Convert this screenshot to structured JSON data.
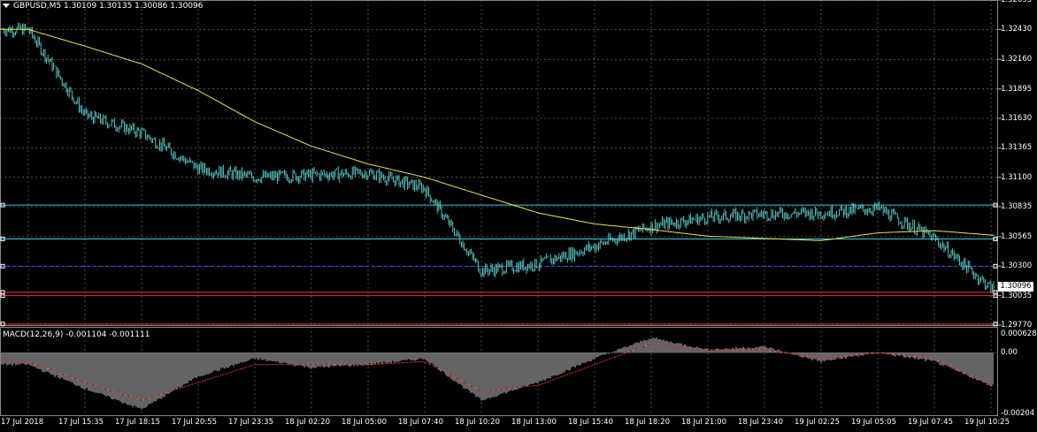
{
  "header": {
    "symbol_line": "GBPUSD,M5  1.30109 1.30135 1.30086 1.30096"
  },
  "price_axis": {
    "labels": [
      "1.32695",
      "1.32430",
      "1.32160",
      "1.31895",
      "1.31630",
      "1.31365",
      "1.31100",
      "1.30835",
      "1.30565",
      "1.30300",
      "1.30035",
      "1.29770"
    ],
    "current_price": "1.30096"
  },
  "time_axis": {
    "labels": [
      "17 Jul 2018",
      "17 Jul 15:35",
      "17 Jul 18:15",
      "17 Jul 20:55",
      "17 Jul 23:35",
      "18 Jul 02:20",
      "18 Jul 05:00",
      "18 Jul 07:40",
      "18 Jul 10:20",
      "18 Jul 13:00",
      "18 Jul 15:40",
      "18 Jul 18:20",
      "18 Jul 21:00",
      "18 Jul 23:40",
      "19 Jul 02:25",
      "19 Jul 05:05",
      "19 Jul 07:45",
      "19 Jul 10:25"
    ]
  },
  "indicator": {
    "title": "MACD(12,26,9) -0.001104 -0.001111",
    "axis_labels": [
      "0.000628",
      "0.00",
      "-0.00204"
    ]
  },
  "colors": {
    "background": "#000000",
    "grid": "#7c7c7c",
    "candles": "#5fd3d3",
    "moving_average": "#e6e64a",
    "level_cyan": "#3cc9d9",
    "level_blue": "#3355ff",
    "level_red": "#e03030",
    "macd_hist": "#c8c8c8",
    "macd_signal": "#e03030"
  },
  "chart_data": [
    {
      "type": "line",
      "title": "",
      "series": [
        {
          "x": [
            "17 Jul 2018",
            "17 Jul 15:35",
            "17 Jul 18:15",
            "17 Jul 20:55",
            "17 Jul 23:35",
            "18 Jul 02:20",
            "18 Jul 05:00",
            "18 Jul 07:40",
            "18 Jul 10:20",
            "18 Jul 13:00",
            "18 Jul 15:40",
            "18 Jul 18:20",
            "18 Jul 21:00",
            "18 Jul 23:40",
            "19 Jul 02:25",
            "19 Jul 05:05",
            "19 Jul 07:45",
            "19 Jul 10:25"
          ],
          "values": [
            1.3243,
            1.3166,
            1.315,
            1.3118,
            1.311,
            1.3112,
            1.3114,
            1.31,
            1.3026,
            1.3032,
            1.3048,
            1.3066,
            1.3074,
            1.3077,
            1.3078,
            1.3082,
            1.3055,
            1.301
          ]
        },
        {
          "x": [
            "17 Jul 2018",
            "17 Jul 15:35",
            "17 Jul 18:15",
            "17 Jul 20:55",
            "17 Jul 23:35",
            "18 Jul 02:20",
            "18 Jul 05:00",
            "18 Jul 07:40",
            "18 Jul 10:20",
            "18 Jul 13:00",
            "18 Jul 15:40",
            "18 Jul 18:20",
            "18 Jul 21:00",
            "18 Jul 23:40",
            "19 Jul 02:25",
            "19 Jul 05:05",
            "19 Jul 07:45",
            "19 Jul 10:25"
          ],
          "values": [
            1.3243,
            1.3228,
            1.3212,
            1.3188,
            1.316,
            1.3138,
            1.3122,
            1.311,
            1.3094,
            1.3078,
            1.3068,
            1.3063,
            1.3057,
            1.3055,
            1.3053,
            1.306,
            1.3062,
            1.3058
          ]
        }
      ],
      "horizontal_levels": [
        1.3085,
        1.30545,
        1.303,
        1.30065,
        1.30035,
        1.2978
      ],
      "ylim": [
        1.2977,
        1.32695
      ]
    },
    {
      "type": "bar",
      "title": "MACD(12,26,9) -0.001104 -0.001111",
      "series": [
        {
          "values": [
            -0.0004,
            -0.0012,
            -0.0019,
            -0.0008,
            -0.0002,
            -0.0005,
            -0.0004,
            -0.0002,
            -0.0016,
            -0.001,
            -0.0002,
            0.0005,
            0.0001,
            0.0002,
            -0.0003,
            0.0,
            -0.0003,
            -0.0011
          ]
        },
        {
          "values": [
            -0.0003,
            -0.001,
            -0.0016,
            -0.001,
            -0.0004,
            -0.0004,
            -0.0004,
            -0.0003,
            -0.0013,
            -0.0011,
            -0.0004,
            0.0003,
            0.0001,
            0.0001,
            -0.0002,
            0.0,
            -0.0002,
            -0.0011
          ]
        }
      ],
      "ylim": [
        -0.00204,
        0.000628
      ]
    }
  ]
}
